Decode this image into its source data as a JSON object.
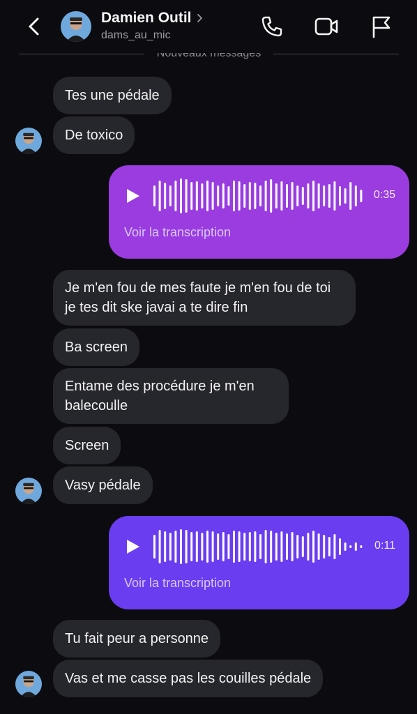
{
  "header": {
    "contact_name": "Damien Outil",
    "username": "dams_au_mic",
    "icons": [
      "back-icon",
      "phone-icon",
      "video-icon",
      "flag-icon"
    ]
  },
  "divider": {
    "label": "Nouveaux messages"
  },
  "messages": [
    {
      "text": "Tes une pédale"
    },
    {
      "text": "De toxico"
    },
    {
      "type": "voice",
      "duration": "0:35",
      "transcript_label": "Voir la transcription",
      "color": "#9a3ce0"
    },
    {
      "text": "Je m'en fou de mes faute je m'en fou de toi je tes dit ske javai a te dire fin"
    },
    {
      "text": "Ba screen"
    },
    {
      "text": "Entame des procédure je m'en balecoulle"
    },
    {
      "text": "Screen"
    },
    {
      "text": "Vasy pédale"
    },
    {
      "type": "voice",
      "duration": "0:11",
      "transcript_label": "Voir la transcription",
      "color": "#6a3df0"
    },
    {
      "text": "Tu fait peur a personne"
    },
    {
      "text": "Vas et me casse pas les couilles pédale"
    }
  ],
  "colors": {
    "background": "#0c0c10",
    "incoming_bubble": "#26272c",
    "voice_top": "#9a3ce0",
    "voice_bottom": "#6a3df0"
  }
}
